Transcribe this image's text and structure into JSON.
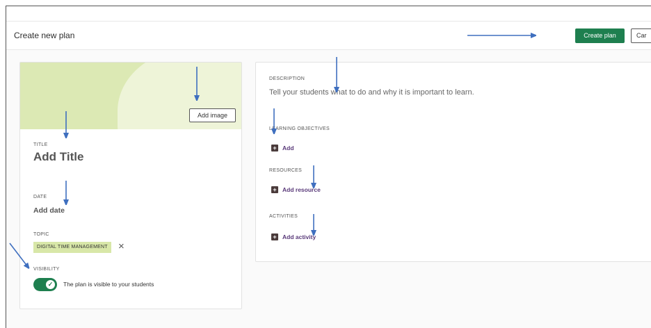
{
  "header": {
    "title": "Create new plan",
    "create_button": "Create plan",
    "cancel_button": "Car"
  },
  "left_card": {
    "add_image_button": "Add image",
    "title_label": "TITLE",
    "title_placeholder": "Add Title",
    "date_label": "DATE",
    "date_placeholder": "Add date",
    "topic_label": "TOPIC",
    "topic_chip": "DIGITAL TIME MANAGEMENT",
    "visibility_label": "VISIBILITY",
    "visibility_text": "The plan is visible to your students",
    "visibility_on": true
  },
  "right_card": {
    "description_label": "DESCRIPTION",
    "description_placeholder": "Tell your students what to do and why it is important to learn.",
    "objectives_label": "LEARNING OBJECTIVES",
    "objectives_add": "Add",
    "resources_label": "RESOURCES",
    "resources_add": "Add resource",
    "activities_label": "ACTIVITIES",
    "activities_add": "Add activity"
  },
  "colors": {
    "primary_green": "#1e7f4f",
    "chip_green": "#d8e7a8",
    "link_purple": "#5a3a7a",
    "annotation_arrow": "#3f6fbf"
  }
}
